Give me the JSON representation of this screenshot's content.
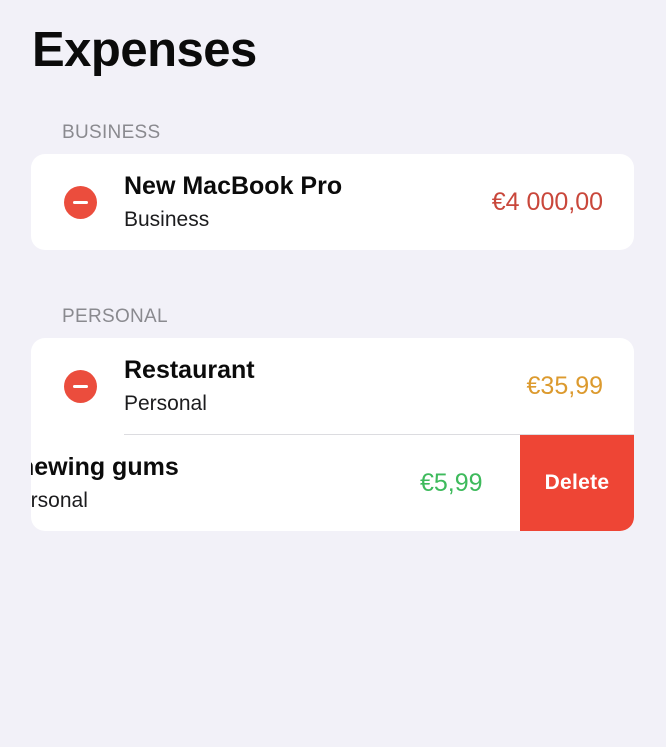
{
  "title": "Expenses",
  "sections": [
    {
      "header": "BUSINESS",
      "items": [
        {
          "name": "New MacBook Pro",
          "type": "Business",
          "amount": "€4 000,00",
          "amount_color": "#c9473b"
        }
      ]
    },
    {
      "header": "PERSONAL",
      "items": [
        {
          "name": "Restaurant",
          "type": "Personal",
          "amount": "€35,99",
          "amount_color": "#dc9a2e"
        },
        {
          "name": "hewing gums",
          "type": "ersonal",
          "amount": "€5,99",
          "amount_color": "#3eba5c",
          "swiped": true
        }
      ]
    }
  ],
  "swipe_action": {
    "label": "Delete",
    "color": "#ee4535"
  },
  "icons": {
    "delete_control": "minus-circle-icon"
  }
}
